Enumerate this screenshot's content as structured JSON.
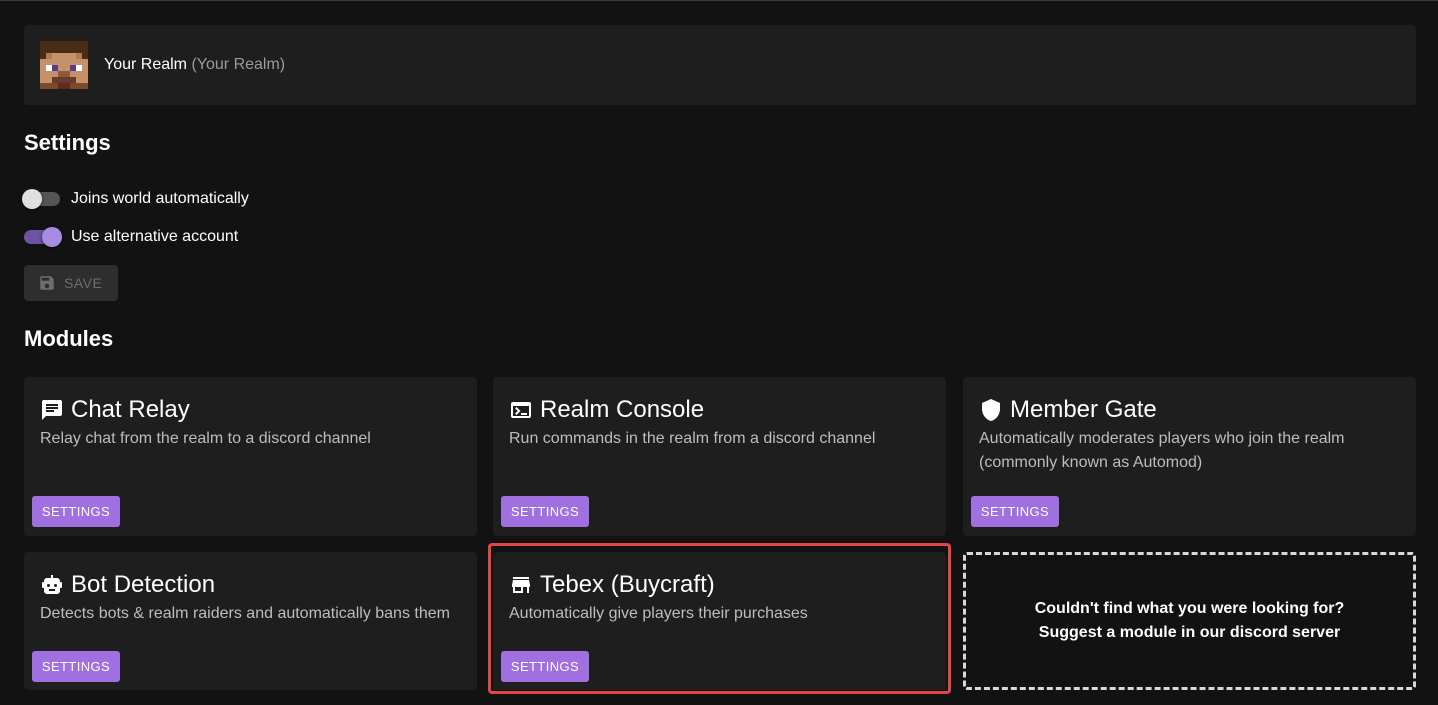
{
  "realm": {
    "name": "Your Realm",
    "subtitle": "(Your Realm)"
  },
  "settings": {
    "heading": "Settings",
    "toggles": [
      {
        "label": "Joins world automatically",
        "checked": false
      },
      {
        "label": "Use alternative account",
        "checked": true
      }
    ],
    "save_label": "SAVE"
  },
  "modules": {
    "heading": "Modules",
    "items": [
      {
        "title": "Chat Relay",
        "description": "Relay chat from the realm to a discord channel",
        "icon": "chat-icon",
        "button": "SETTINGS"
      },
      {
        "title": "Realm Console",
        "description": "Run commands in the realm from a discord channel",
        "icon": "console-icon",
        "button": "SETTINGS"
      },
      {
        "title": "Member Gate",
        "description": "Automatically moderates players who join the realm (commonly known as Automod)",
        "icon": "shield-icon",
        "button": "SETTINGS"
      },
      {
        "title": "Bot Detection",
        "description": "Detects bots & realm raiders and automatically bans them",
        "icon": "robot-icon",
        "button": "SETTINGS"
      },
      {
        "title": "Tebex (Buycraft)",
        "description": "Automatically give players their purchases",
        "icon": "store-icon",
        "button": "SETTINGS"
      }
    ],
    "suggest": {
      "line1": "Couldn't find what you were looking for?",
      "line2": "Suggest a module in our discord server"
    }
  },
  "colors": {
    "background": "#121212",
    "card": "#1e1e1e",
    "accent": "#a070e0",
    "highlight": "#e04848"
  }
}
